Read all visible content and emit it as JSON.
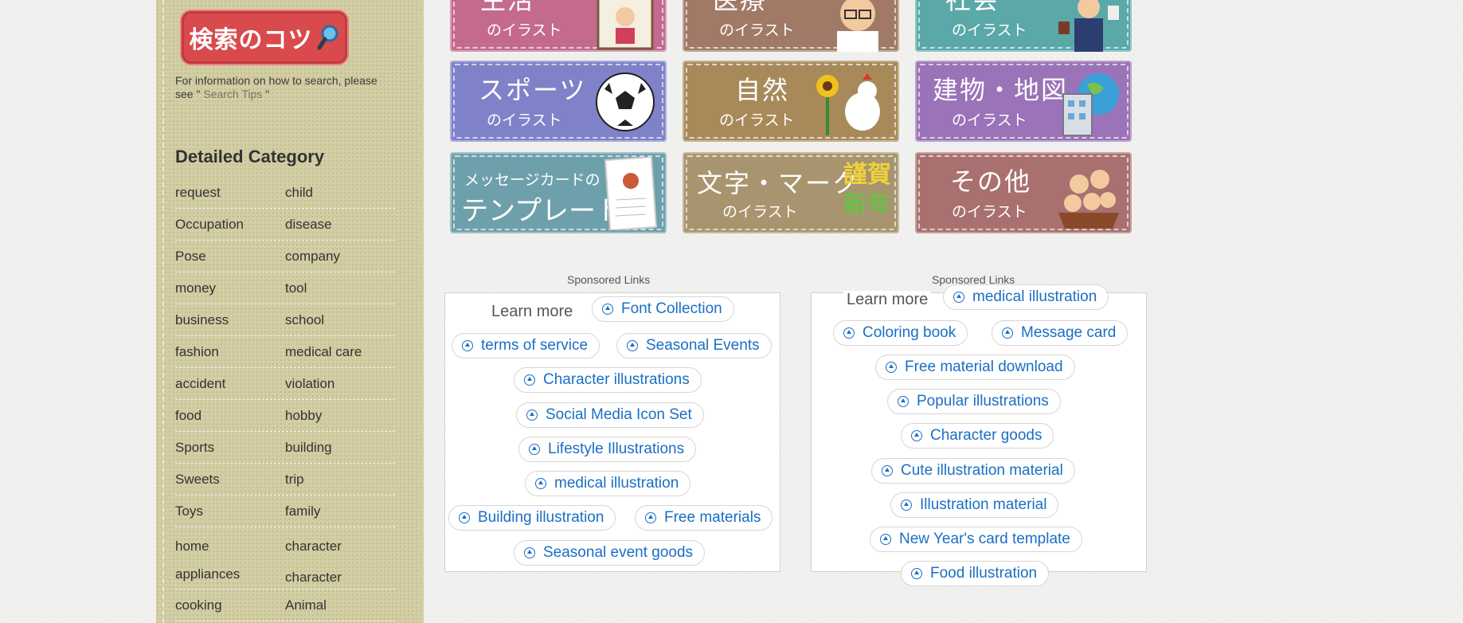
{
  "sidebar": {
    "search_tips_banner": "検索のコツ",
    "search_info": "For information on how to search, please see \" ",
    "search_info_link": "Search Tips",
    "search_info_end": " \"",
    "category_heading": "Detailed Category",
    "categories": [
      [
        "request",
        "child"
      ],
      [
        "Occupation",
        "disease"
      ],
      [
        "Pose",
        "company"
      ],
      [
        "money",
        "tool"
      ],
      [
        "business",
        "school"
      ],
      [
        "fashion",
        "medical care"
      ],
      [
        "accident",
        "violation"
      ],
      [
        "food",
        "hobby"
      ],
      [
        "Sports",
        "building"
      ],
      [
        "Sweets",
        "trip"
      ],
      [
        "Toys",
        "family"
      ],
      [
        "home",
        "character"
      ],
      [
        "appliances",
        "character"
      ],
      [
        "cooking",
        "Animal"
      ]
    ]
  },
  "tiles": [
    {
      "main": "生活",
      "sub": "のイラスト",
      "color": "#c46a8e"
    },
    {
      "main": "医療",
      "sub": "のイラスト",
      "color": "#a07a66"
    },
    {
      "main": "社会",
      "sub": "のイラスト",
      "color": "#5aa8a8"
    },
    {
      "main": "スポーツ",
      "sub": "のイラスト",
      "color": "#7f82c9"
    },
    {
      "main": "自然",
      "sub": "のイラスト",
      "color": "#a88a5a"
    },
    {
      "main": "建物・地図",
      "sub": "のイラスト",
      "color": "#9a73b8"
    },
    {
      "main": "テンプレート",
      "sub": "メッセージカードの",
      "color": "#6ea0ab"
    },
    {
      "main": "文字・マーク",
      "sub": "のイラスト",
      "color": "#a8946e"
    },
    {
      "main": "その他",
      "sub": "のイラスト",
      "color": "#a8706e"
    }
  ],
  "tile_extras": {
    "kanji_greeting_1": "謹賀",
    "kanji_greeting_2": "新年"
  },
  "sponsored_left": {
    "label": "Sponsored Links",
    "learn_more": "Learn more",
    "links": [
      "Font Collection",
      "terms of service",
      "Seasonal Events",
      "Character illustrations",
      "Social Media Icon Set",
      "Lifestyle Illustrations",
      "medical illustration",
      "Building illustration",
      "Free materials",
      "Seasonal event goods"
    ]
  },
  "sponsored_right": {
    "label": "Sponsored Links",
    "learn_more": "Learn more",
    "links": [
      "medical illustration",
      "Coloring book",
      "Message card",
      "Free material download",
      "Popular illustrations",
      "Character goods",
      "Cute illustration material",
      "Illustration material",
      "New Year's card template",
      "Food illustration"
    ]
  }
}
